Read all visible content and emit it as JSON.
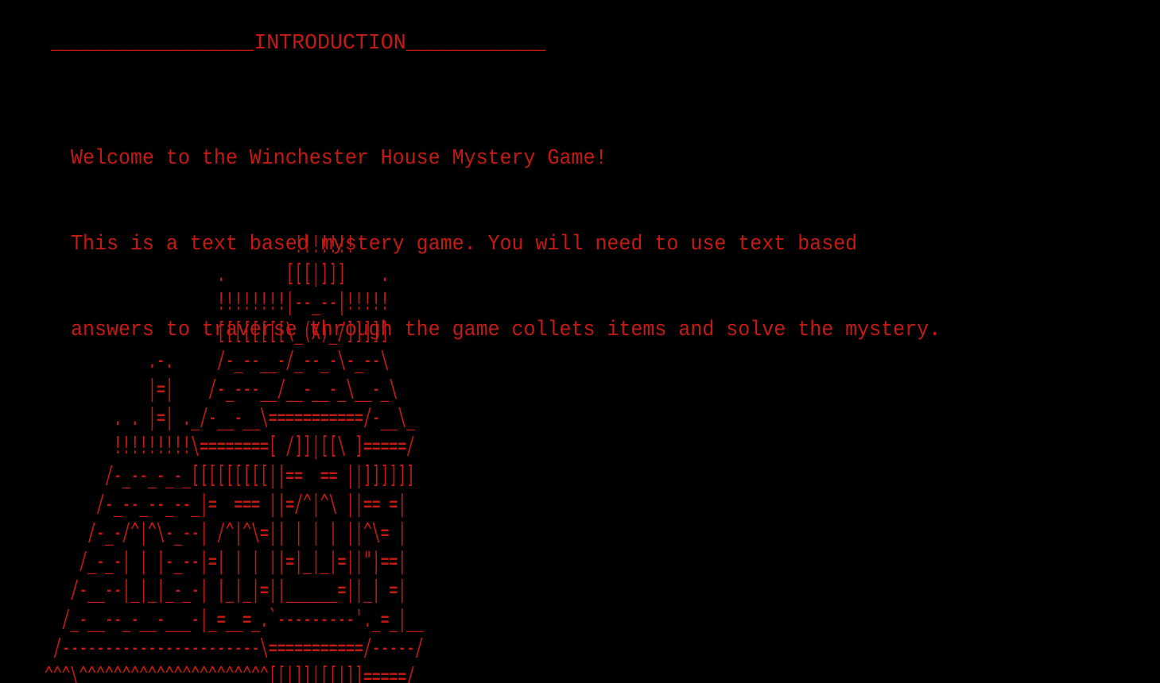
{
  "section": {
    "heading": "    ________________INTRODUCTION___________"
  },
  "intro": {
    "line1": "Welcome to the Winchester House Mystery Game!",
    "line2": "This is a text based mystery game. You will need to use text based",
    "line3": "answers to traverse through the game collets items and solve the mystery."
  },
  "ascii_art": {
    "lines": [
      "                             !!!!!!!",
      "                    .       [[[|]]]    .",
      "                    !!!!!!!!|--_--|!!!!!",
      "                    [[[[[[[[\\_(X)_/]]]]]",
      "            .-.     /-_--__-/_--_-\\-_--\\",
      "            |=|    /-_---__/__-__-_\\__-_\\",
      "        . . |=| ._/-__-__\\===========/-__\\_",
      "        !!!!!!!!!\\========[ /]]|[[\\ ]=====/",
      "       /-_--_-_-_[[[[[[[[[||==  == ||]]]]]]",
      "      /-_--_--_--_|=  === ||=/^|^\\ ||== =|",
      "     /-_-/^|^\\-_--| /^|^\\=|| | | | ||^\\= |",
      "    /_-_-| | |-_--|=| | | ||=|_|_|=||\"|==|",
      "   /-__--|_|_|_-_-| |_|_|=||______=||_| =|",
      "  /_-__--_-__-___-|_=__=_.`---------'._=_|__",
      " /-----------------------\\===========/-----/",
      "^^^\\^^^^^^^^^^^^^^^^^^^^^^[[|]]|[[|]]=====/"
    ]
  }
}
